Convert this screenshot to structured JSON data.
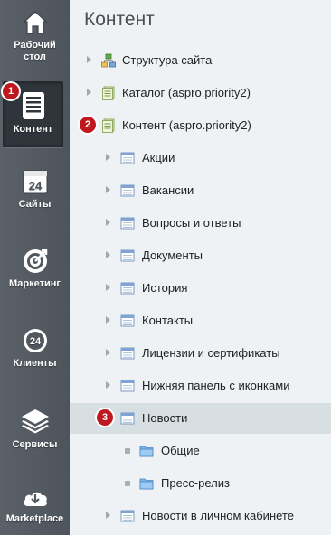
{
  "sidebar": {
    "items": [
      {
        "label_line1": "Рабочий",
        "label_line2": "стол",
        "icon": "home-icon"
      },
      {
        "label": "Контент",
        "icon": "document-icon",
        "badge": "1"
      },
      {
        "label": "Сайты",
        "icon": "calendar-24-icon",
        "icon_text": "24"
      },
      {
        "label": "Маркетинг",
        "icon": "target-icon"
      },
      {
        "label": "Клиенты",
        "icon": "clients-24-icon",
        "icon_text": "24"
      },
      {
        "label": "Сервисы",
        "icon": "layers-icon"
      },
      {
        "label": "Marketplace",
        "icon": "cloud-download-icon"
      }
    ]
  },
  "main": {
    "title": "Контент",
    "tree": [
      {
        "label": "Структура сайта",
        "icon": "sitemap-icon"
      },
      {
        "label": "Каталог (aspro.priority2)",
        "icon": "iblock-type-icon"
      },
      {
        "label": "Контент (aspro.priority2)",
        "icon": "iblock-type-icon",
        "badge": "2"
      },
      {
        "label": "Акции",
        "icon": "iblock-icon"
      },
      {
        "label": "Вакансии",
        "icon": "iblock-icon"
      },
      {
        "label": "Вопросы и ответы",
        "icon": "iblock-icon"
      },
      {
        "label": "Документы",
        "icon": "iblock-icon"
      },
      {
        "label": "История",
        "icon": "iblock-icon"
      },
      {
        "label": "Контакты",
        "icon": "iblock-icon"
      },
      {
        "label": "Лицензии и сертификаты",
        "icon": "iblock-icon"
      },
      {
        "label": "Нижняя панель с иконками",
        "icon": "iblock-icon"
      },
      {
        "label": "Новости",
        "icon": "iblock-icon",
        "badge": "3"
      },
      {
        "label": "Общие",
        "icon": "folder-icon"
      },
      {
        "label": "Пресс-релиз",
        "icon": "folder-icon"
      },
      {
        "label": "Новости в личном кабинете",
        "icon": "iblock-icon"
      }
    ]
  },
  "colors": {
    "badge": "#c0181f",
    "sidebar": "#51585f",
    "selected_row": "#d7dfe3"
  }
}
